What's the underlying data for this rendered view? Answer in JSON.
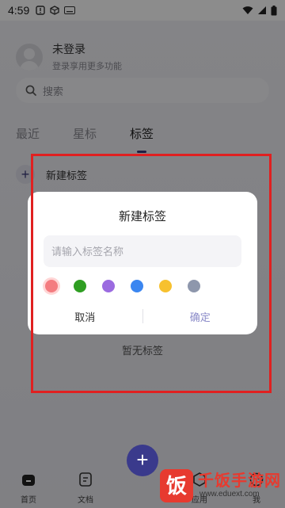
{
  "status_bar": {
    "time": "4:59"
  },
  "profile": {
    "name": "未登录",
    "subtitle": "登录享用更多功能"
  },
  "search": {
    "placeholder": "搜索"
  },
  "tabs": [
    {
      "label": "最近",
      "active": false
    },
    {
      "label": "星标",
      "active": false
    },
    {
      "label": "标签",
      "active": true
    }
  ],
  "new_tag_row": {
    "label": "新建标签"
  },
  "empty_state": {
    "text": "暂无标签"
  },
  "dialog": {
    "title": "新建标签",
    "input_placeholder": "请输入标签名称",
    "input_value": "",
    "colors": [
      "#f47c80",
      "#2f9e22",
      "#9b6be0",
      "#3b86f0",
      "#f7c12f",
      "#8e97ac"
    ],
    "selected_color_index": 0,
    "cancel_label": "取消",
    "confirm_label": "确定"
  },
  "bottom_nav": {
    "items": [
      {
        "label": "首页",
        "icon": "home-icon"
      },
      {
        "label": "文档",
        "icon": "document-icon"
      },
      {
        "label": "应用",
        "icon": "apps-icon"
      },
      {
        "label": "我",
        "icon": "profile-icon"
      }
    ],
    "fab_icon": "plus-icon"
  },
  "watermark": {
    "logo_char": "饭",
    "name": "千饭手游网",
    "url": "www.eduext.com"
  }
}
